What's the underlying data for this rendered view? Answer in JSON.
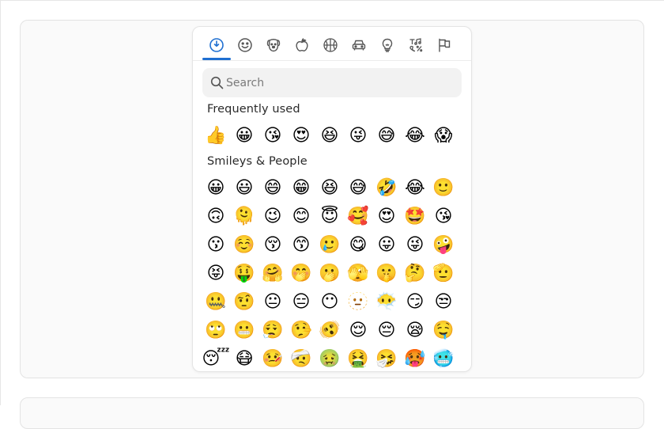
{
  "picker": {
    "categories": [
      {
        "name": "recent",
        "icon": "clock-icon",
        "active": true
      },
      {
        "name": "smileys",
        "icon": "smiley-icon",
        "active": false
      },
      {
        "name": "animals",
        "icon": "dog-icon",
        "active": false
      },
      {
        "name": "food",
        "icon": "apple-icon",
        "active": false
      },
      {
        "name": "activity",
        "icon": "basketball-icon",
        "active": false
      },
      {
        "name": "travel",
        "icon": "car-icon",
        "active": false
      },
      {
        "name": "objects",
        "icon": "lightbulb-icon",
        "active": false
      },
      {
        "name": "symbols",
        "icon": "symbols-icon",
        "active": false
      },
      {
        "name": "flags",
        "icon": "flag-icon",
        "active": false
      }
    ],
    "accent_color": "#1f6fd1",
    "icon_color": "#555555",
    "search": {
      "placeholder": "Search",
      "value": ""
    },
    "sections": {
      "frequent": {
        "title": "Frequently used",
        "emojis": [
          "👍",
          "😀",
          "😘",
          "😍",
          "😆",
          "😜",
          "😅",
          "😂",
          "😱"
        ]
      },
      "smileys": {
        "title": "Smileys & People",
        "rows": [
          [
            "😀",
            "😃",
            "😄",
            "😁",
            "😆",
            "😅",
            "🤣",
            "😂",
            "🙂"
          ],
          [
            "🙃",
            "🫠",
            "😉",
            "😊",
            "😇",
            "🥰",
            "😍",
            "🤩",
            "😘"
          ],
          [
            "😗",
            "☺️",
            "😚",
            "😙",
            "🥲",
            "😋",
            "😛",
            "😜",
            "🤪"
          ],
          [
            "😝",
            "🤑",
            "🤗",
            "🤭",
            "🫢",
            "🫣",
            "🤫",
            "🤔",
            "🫡"
          ],
          [
            "🤐",
            "🤨",
            "😐",
            "😑",
            "😶",
            "🫥",
            "😶‍🌫️",
            "😏",
            "😒"
          ],
          [
            "🙄",
            "😬",
            "😮‍💨",
            "🤥",
            "🫨",
            "😌",
            "😔",
            "😪",
            "🤤"
          ],
          [
            "😴",
            "😷",
            "🤒",
            "🤕",
            "🤢",
            "🤮",
            "🤧",
            "🥵",
            "🥶"
          ]
        ]
      }
    }
  }
}
